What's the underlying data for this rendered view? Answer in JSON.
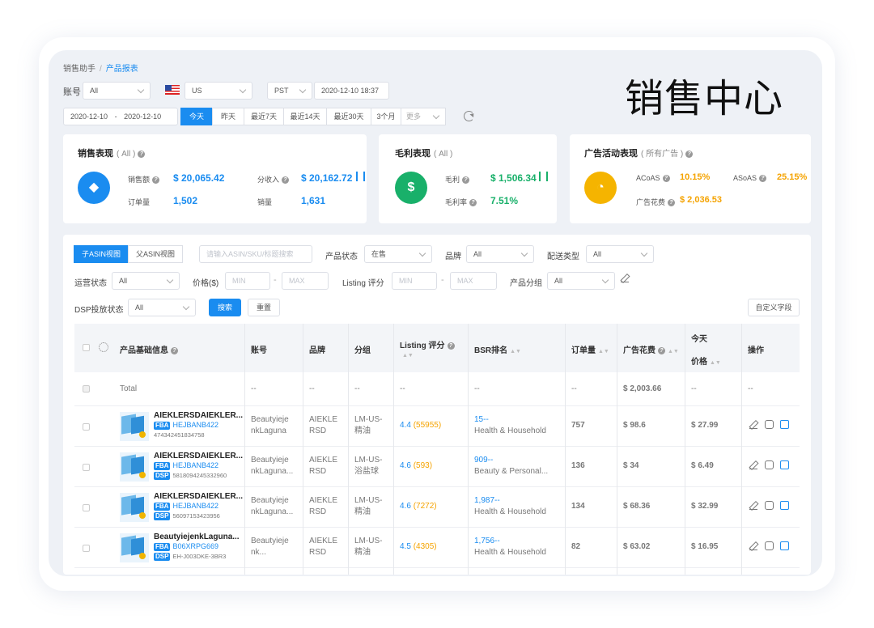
{
  "big_title": "销售中心",
  "breadcrumb": {
    "parent": "销售助手",
    "sep": "/",
    "current": "产品报表"
  },
  "filters_top": {
    "account_label": "账号",
    "account_value": "All",
    "market_value": "US",
    "timezone_value": "PST",
    "datetime_value": "2020-12-10 18:37",
    "date_start": "2020-12-10",
    "date_sep": "-",
    "date_end": "2020-12-10",
    "quick_ranges": [
      "今天",
      "昨天",
      "最近7天",
      "最近14天",
      "最近30天",
      "3个月"
    ],
    "more_label": "更多"
  },
  "sales_panel": {
    "title": "销售表现",
    "scope": "( All )",
    "items": [
      {
        "label": "销售额",
        "value": "$ 20,065.42"
      },
      {
        "label": "分收入",
        "value": "$ 20,162.72"
      },
      {
        "label": "订单量",
        "value": "1,502"
      },
      {
        "label": "销量",
        "value": "1,631"
      }
    ]
  },
  "profit_panel": {
    "title": "毛利表现",
    "scope": "( All )",
    "items": [
      {
        "label": "毛利",
        "value": "$ 1,506.34"
      },
      {
        "label": "毛利率",
        "value": "7.51%"
      }
    ]
  },
  "ad_panel": {
    "title": "广告活动表现",
    "scope": "( 所有广告 )",
    "items": [
      {
        "label": "ACoAS",
        "value": "10.15%"
      },
      {
        "label": "ASoAS",
        "value": "25.15%"
      },
      {
        "label": "广告花费",
        "value": "$ 2,036.53"
      }
    ]
  },
  "view_tabs": [
    "子ASIN视图",
    "父ASIN视图"
  ],
  "search_placeholder": "请输入ASIN/SKU/标题搜索",
  "filters": {
    "status_label": "产品状态",
    "status_value": "在售",
    "brand_label": "品牌",
    "brand_value": "All",
    "ship_label": "配送类型",
    "ship_value": "All",
    "ops_label": "运营状态",
    "ops_value": "All",
    "price_label": "价格($)",
    "min_ph": "MIN",
    "range_sep": "-",
    "max_ph": "MAX",
    "listing_label": "Listing 评分",
    "group_label": "产品分组",
    "group_value": "All",
    "dsp_label": "DSP投放状态",
    "dsp_value": "All",
    "search_btn": "搜索",
    "reset_btn": "重置",
    "custom_btn": "自定义字段"
  },
  "table": {
    "headers": {
      "product": "产品基础信息",
      "account": "账号",
      "brand": "品牌",
      "group": "分组",
      "listing": "Listing 评分",
      "bsr": "BSR排名",
      "orders": "订单量",
      "ad_spend": "广告花费",
      "today": "今天",
      "price": "价格",
      "actions": "操作"
    },
    "total_row": {
      "label": "Total",
      "account": "--",
      "brand": "--",
      "group": "--",
      "listing": "--",
      "bsr": "--",
      "orders": "--",
      "ad_spend": "$ 2,003.66",
      "price": "--",
      "actions": "--"
    },
    "rows": [
      {
        "name": "AIEKLERSDAIEKLER...",
        "tag1": "FBA",
        "sku": "HEJBANB422",
        "tag2": "",
        "code": "474342451834758",
        "account1": "Beautyieje",
        "account2": "nkLaguna",
        "brand1": "AIEKLE",
        "brand2": "RSD",
        "group1": "LM-US-",
        "group2": "精油",
        "rating": "4.4",
        "reviews": "(55955)",
        "bsr_rank": "15--",
        "bsr_cat": "Health & Household",
        "orders": "757",
        "ad_spend": "$ 98.6",
        "price": "$ 27.99"
      },
      {
        "name": "AIEKLERSDAIEKLER...",
        "tag1": "FBA",
        "sku": "HEJBANB422",
        "tag2": "DSP",
        "code": "5818094245332960",
        "account1": "Beautyieje",
        "account2": "nkLaguna...",
        "brand1": "AIEKLE",
        "brand2": "RSD",
        "group1": "LM-US-",
        "group2": "浴盐球",
        "rating": "4.6",
        "reviews": "(593)",
        "bsr_rank": "909--",
        "bsr_cat": "Beauty & Personal...",
        "orders": "136",
        "ad_spend": "$ 34",
        "price": "$ 6.49"
      },
      {
        "name": "AIEKLERSDAIEKLER...",
        "tag1": "FBA",
        "sku": "HEJBANB422",
        "tag2": "DSP",
        "code": "56097153423956",
        "account1": "Beautyieje",
        "account2": "nkLaguna...",
        "brand1": "AIEKLE",
        "brand2": "RSD",
        "group1": "LM-US-",
        "group2": "精油",
        "rating": "4.6",
        "reviews": "(7272)",
        "bsr_rank": "1,987--",
        "bsr_cat": "Health & Household",
        "orders": "134",
        "ad_spend": "$ 68.36",
        "price": "$ 32.99"
      },
      {
        "name": "BeautyiejenkLaguna...",
        "tag1": "FBA",
        "sku": "B06XRPG669",
        "tag2": "DSP",
        "code": "EH-J003DKE-3BR3",
        "account1": "Beautyieje",
        "account2": "nk...",
        "brand1": "AIEKLE",
        "brand2": "RSD",
        "group1": "LM-US-",
        "group2": "精油",
        "rating": "4.5",
        "reviews": "(4305)",
        "bsr_rank": "1,756--",
        "bsr_cat": "Health & Household",
        "orders": "82",
        "ad_spend": "$ 63.02",
        "price": "$ 16.95"
      }
    ]
  },
  "colors": {
    "primary": "#1a8cf0",
    "green": "#19b06a",
    "orange": "#f5a300"
  }
}
